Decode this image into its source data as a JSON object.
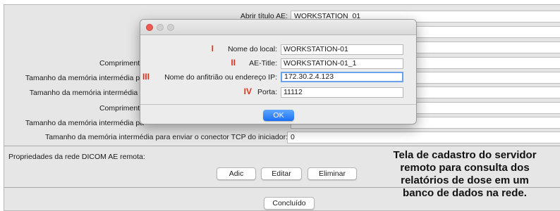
{
  "settings_window": {
    "rows": [
      {
        "label": "Abrir título AE:",
        "value": "WORKSTATION_01"
      },
      {
        "label": "Comprimento",
        "value": ""
      },
      {
        "label": "Tamanho da memória intermédia pa",
        "value": ""
      },
      {
        "label": "Tamanho da memória intermédia p",
        "value": ""
      },
      {
        "label": "Comprimento",
        "value": ""
      },
      {
        "label": "Tamanho da memória intermédia pa",
        "value": ""
      },
      {
        "label": "Tamanho da memória intermédia para enviar o conector TCP do iniciador:",
        "value": "0"
      }
    ],
    "remote_section_label": "Propriedades da rede DICOM AE remota:",
    "buttons": {
      "add": "Adic",
      "edit": "Editar",
      "delete": "Eliminar"
    },
    "done_button": "Concluído"
  },
  "dialog": {
    "fields": [
      {
        "marker": "I",
        "label": "Nome do local:",
        "value": "WORKSTATION-01"
      },
      {
        "marker": "II",
        "label": "AE-Title:",
        "value": "WORKSTATION-01_1"
      },
      {
        "marker": "III",
        "label": "Nome do anfitrião ou endereço IP:",
        "value": "172.30.2.4.123"
      },
      {
        "marker": "IV",
        "label": "Porta:",
        "value": "11112"
      }
    ],
    "ok_label": "OK"
  },
  "caption": "Tela de cadastro do servidor\nremoto para consulta dos\nrelatórios de dose em um\nbanco de dados na rede.",
  "colors": {
    "marker": "#e0301e",
    "traffic_close": "#ee5b52",
    "traffic_inactive": "#cfcfcf",
    "ok_button": "#1b6ff5",
    "focus_ring": "#6aa2e8"
  }
}
